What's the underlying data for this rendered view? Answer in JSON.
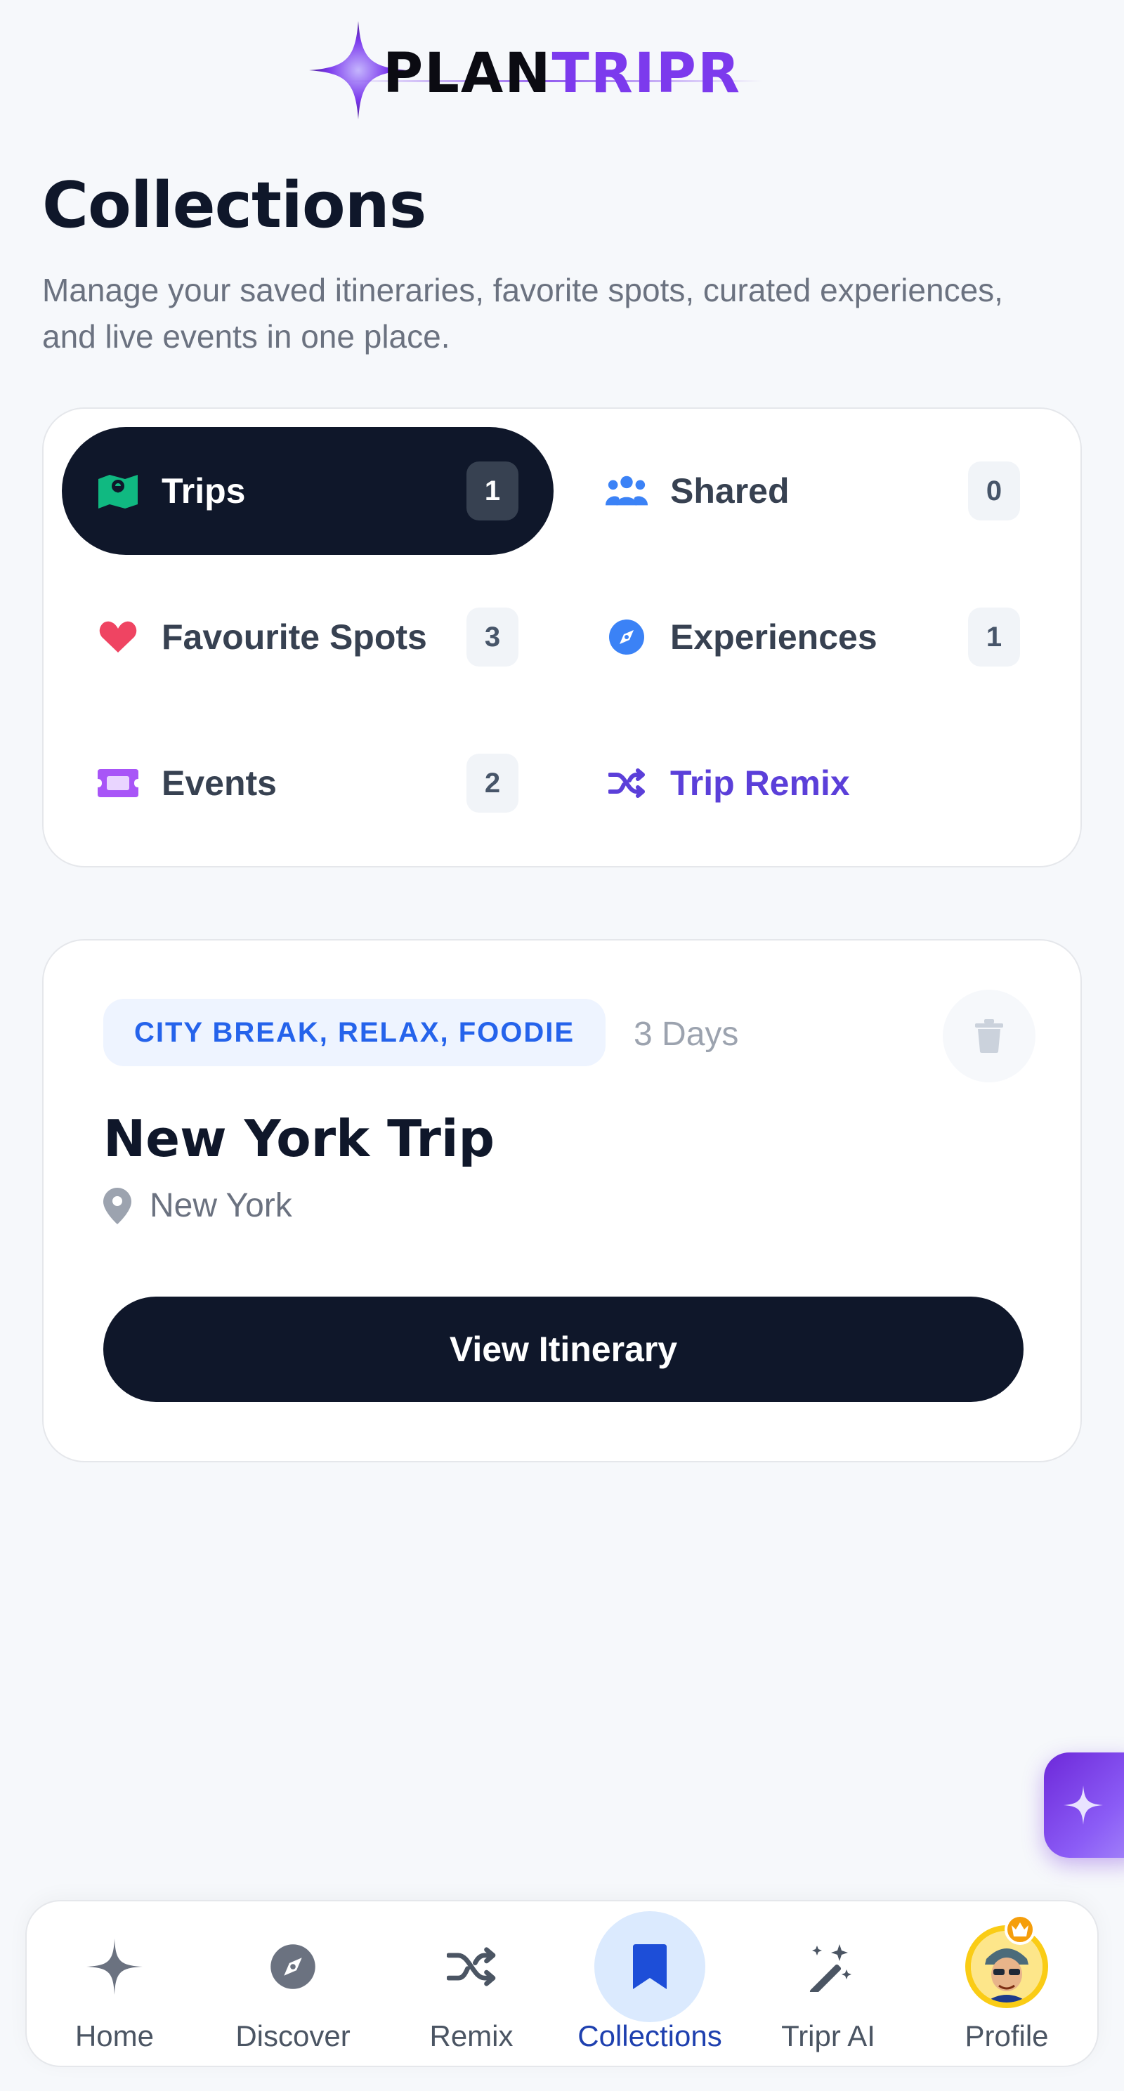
{
  "brand": {
    "part1": "PLAN",
    "part2": "TRIPR",
    "accent": "#7c3aed"
  },
  "page": {
    "title": "Collections",
    "subtitle": "Manage your saved itineraries, favorite spots, curated experiences, and live events in one place."
  },
  "categories": [
    {
      "label": "Trips",
      "count": "1",
      "icon": "map-icon",
      "active": true
    },
    {
      "label": "Shared",
      "count": "0",
      "icon": "users-icon"
    },
    {
      "label": "Favourite Spots",
      "count": "3",
      "icon": "heart-icon"
    },
    {
      "label": "Experiences",
      "count": "1",
      "icon": "compass-icon"
    },
    {
      "label": "Events",
      "count": "2",
      "icon": "ticket-icon"
    },
    {
      "label": "Trip Remix",
      "icon": "shuffle-icon"
    }
  ],
  "trip": {
    "tags": "CITY BREAK, RELAX, FOODIE",
    "duration": "3 Days",
    "title": "New York Trip",
    "location": "New York",
    "button_label": "View Itinerary"
  },
  "nav": [
    {
      "label": "Home",
      "icon": "sparkle-icon"
    },
    {
      "label": "Discover",
      "icon": "compass-icon"
    },
    {
      "label": "Remix",
      "icon": "shuffle-icon"
    },
    {
      "label": "Collections",
      "icon": "bookmark-icon",
      "active": true
    },
    {
      "label": "Tripr AI",
      "icon": "magic-wand-icon"
    },
    {
      "label": "Profile",
      "icon": "avatar"
    }
  ],
  "colors": {
    "dark": "#0f172a",
    "active_nav": "#1e40af",
    "heart": "#ef4462",
    "compass": "#3b82f6",
    "ticket": "#a855f7",
    "remix": "#5b3fd9",
    "map": "#10b981"
  }
}
